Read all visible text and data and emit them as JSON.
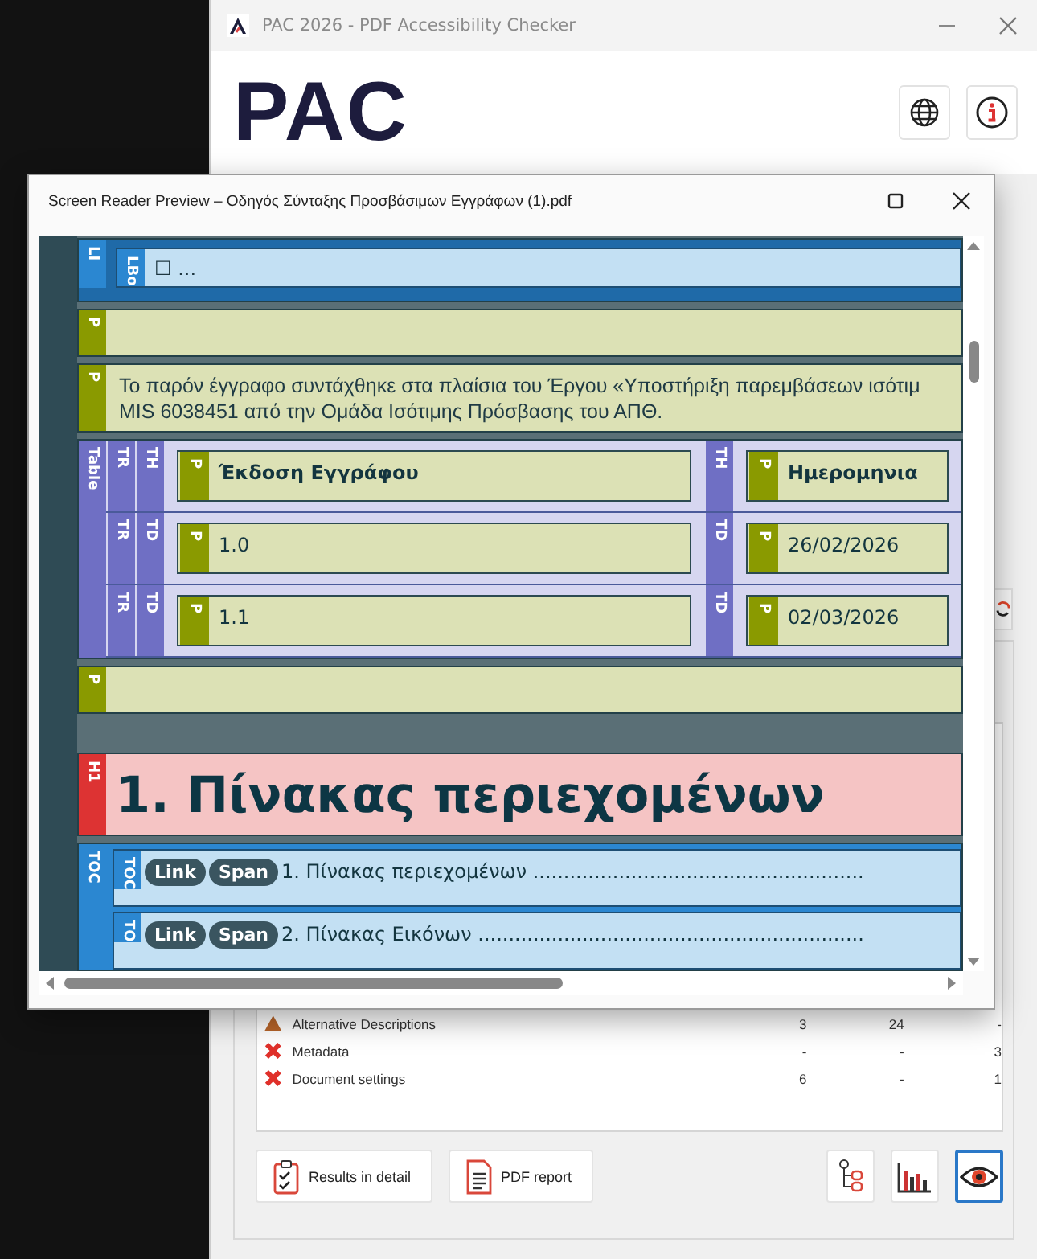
{
  "app": {
    "title": "PAC 2026 - PDF Accessibility Checker",
    "logo": "PAC"
  },
  "results": [
    {
      "kind": "warning",
      "name": "Alternative Descriptions",
      "values": [
        "3",
        "24",
        "-"
      ]
    },
    {
      "kind": "error",
      "name": "Metadata",
      "values": [
        "-",
        "-",
        "3"
      ]
    },
    {
      "kind": "error",
      "name": "Document settings",
      "values": [
        "6",
        "-",
        "1"
      ]
    }
  ],
  "buttons": [
    "Results in detail",
    "PDF report"
  ],
  "tool_buttons": [
    {
      "selected": false
    },
    {
      "selected": false
    },
    {
      "selected": true
    }
  ],
  "preview": {
    "title": "Screen Reader Preview – Οδηγός Σύνταξης Προσβάσιμων Εγγράφων (1).pdf",
    "nodes": [
      {
        "kind": "list_item",
        "tag": "LI",
        "body_tag": "LBo",
        "text": "☐ ..."
      },
      {
        "kind": "paragraph",
        "tag": "P"
      },
      {
        "kind": "paragraph",
        "tag": "P",
        "lines": [
          "Το παρόν έγγραφο συντάχθηκε στα πλαίσια του Έργου «Υποστήριξη παρεμβάσεων ισότιμ",
          "MIS 6038451 από την Ομάδα Ισότιμης Πρόσβασης του ΑΠΘ."
        ]
      },
      {
        "kind": "table",
        "tag": "Table",
        "rows": [
          {
            "tag": "TR",
            "cells": [
              {
                "kind": "header",
                "tag": "TH",
                "p_tag": "P",
                "text": "Έκδοση Εγγράφου"
              },
              {
                "kind": "header",
                "tag": "TH",
                "p_tag": "P",
                "text": "Ημερομηνια"
              }
            ]
          },
          {
            "tag": "TR",
            "cells": [
              {
                "kind": "data",
                "tag": "TD",
                "p_tag": "P",
                "text": "1.0"
              },
              {
                "kind": "data",
                "tag": "TD",
                "p_tag": "P",
                "text": "26/02/2026"
              }
            ]
          },
          {
            "tag": "TR",
            "cells": [
              {
                "kind": "data",
                "tag": "TD",
                "p_tag": "P",
                "text": "1.1"
              },
              {
                "kind": "data",
                "tag": "TD",
                "p_tag": "P",
                "text": "02/03/2026"
              }
            ]
          }
        ]
      },
      {
        "kind": "paragraph",
        "tag": "P"
      },
      {
        "kind": "heading",
        "tag": "H1",
        "text": "1. Πίνακας περιεχομένων"
      },
      {
        "kind": "toc",
        "tag": "TOC",
        "items": [
          {
            "tag": "TOC",
            "link": "Link",
            "span": "Span",
            "text": "1. Πίνακας περιεχομένων ......................................................"
          },
          {
            "tag": "TO",
            "link": "Link",
            "span": "Span",
            "text": "2. Πίνακας Εικόνων ..............................................................."
          }
        ]
      }
    ]
  }
}
